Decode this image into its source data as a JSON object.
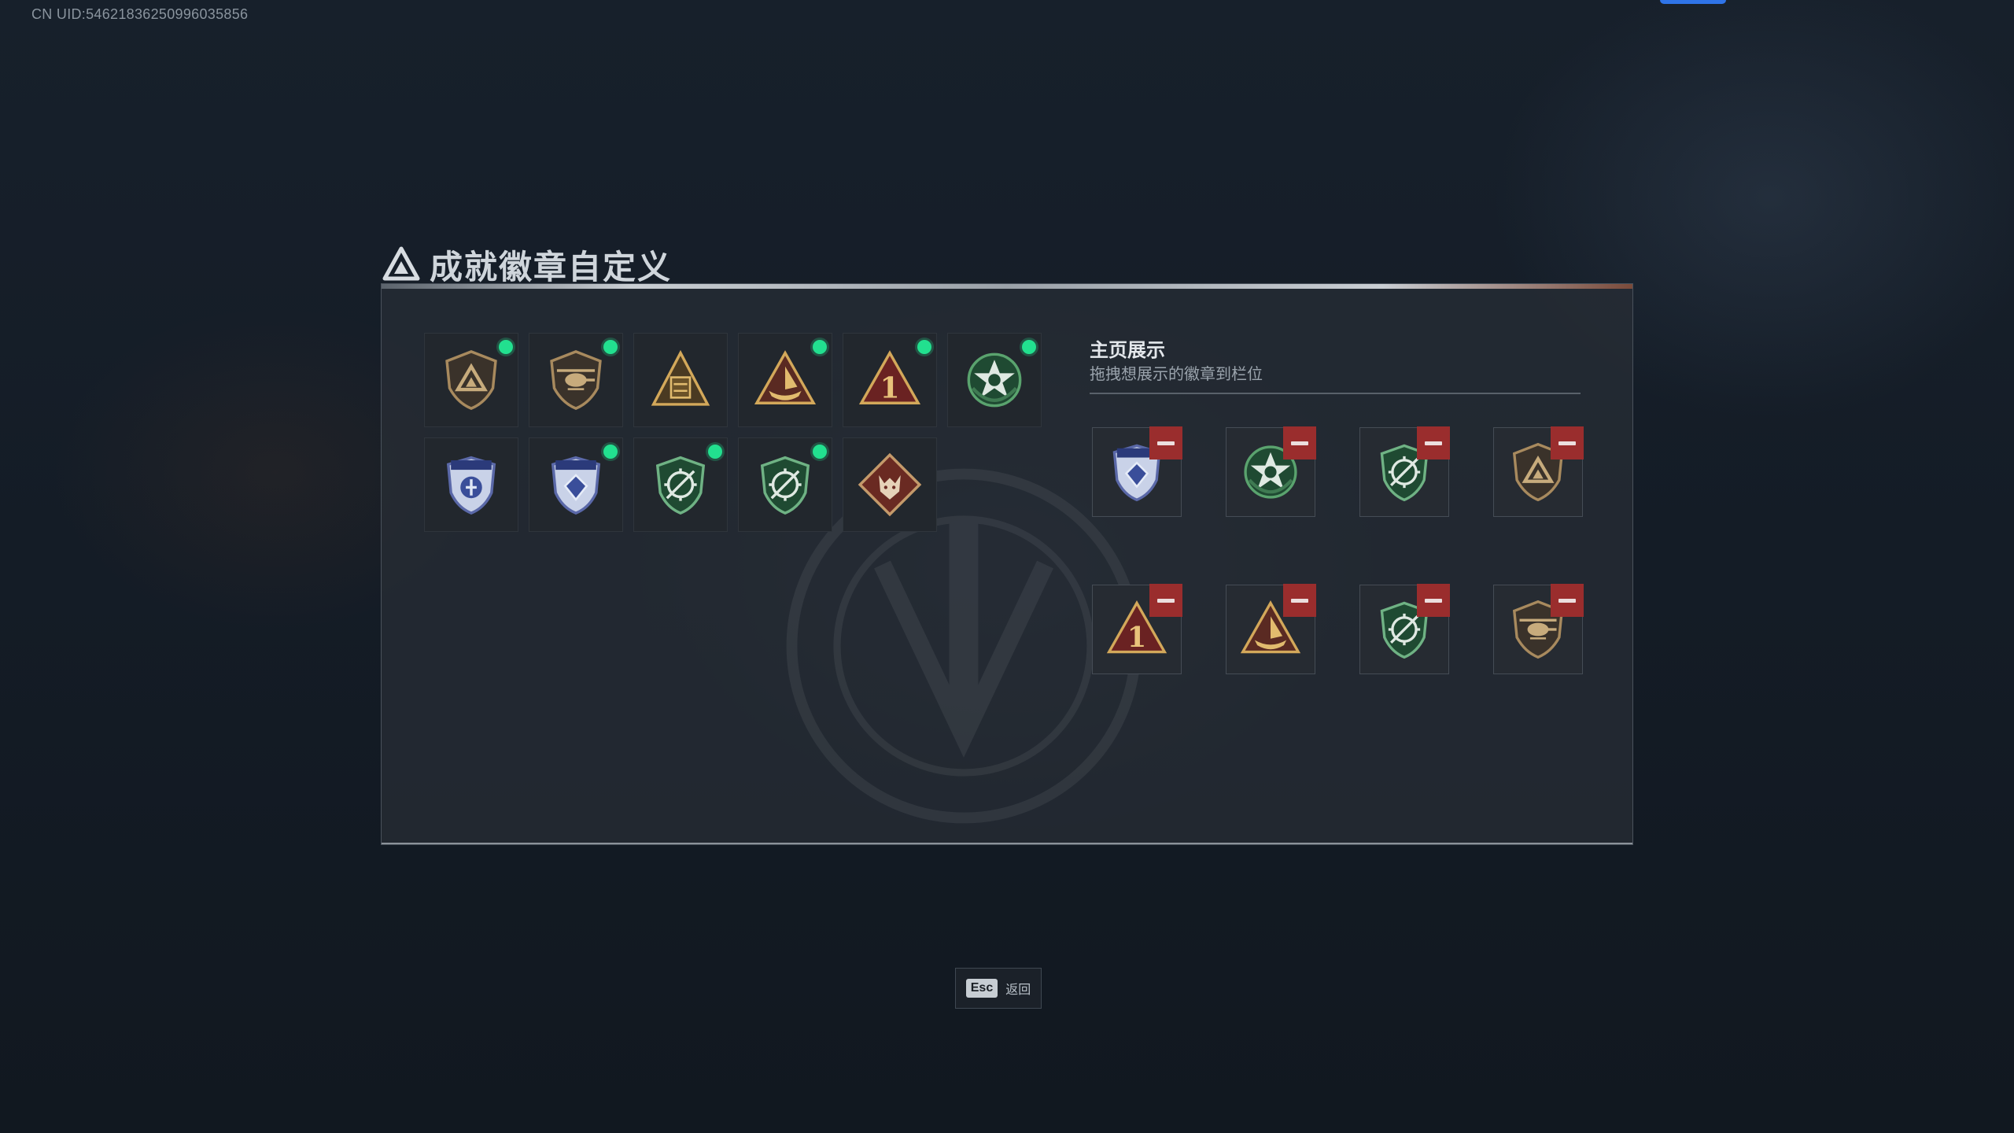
{
  "header": {
    "uid": "CN UID:546218362509960358​56"
  },
  "page": {
    "title": "成就徽章自定义"
  },
  "inventory": {
    "badges": [
      {
        "icon": "bronze-shield-triangle-badge",
        "new": true
      },
      {
        "icon": "bronze-helicopter-badge",
        "new": true
      },
      {
        "icon": "gold-pyramid-crate-badge",
        "new": false
      },
      {
        "icon": "gold-triangle-boat-badge",
        "new": true
      },
      {
        "icon": "red-triangle-number-one-badge",
        "new": true
      },
      {
        "icon": "green-star-wreath-badge",
        "new": true
      },
      {
        "icon": "blue-shield-emblem-badge",
        "new": false
      },
      {
        "icon": "blue-shield-diamond-badge",
        "new": true
      },
      {
        "icon": "green-shield-crosshair-badge",
        "new": true
      },
      {
        "icon": "green-shield-crosshair-badge",
        "new": true
      },
      {
        "icon": "red-diamond-wolf-badge",
        "new": false
      }
    ]
  },
  "display": {
    "title": "主页展示",
    "subtitle": "拖拽想展示的徽章到栏位",
    "slots": [
      {
        "icon": "blue-shield-diamond-badge"
      },
      {
        "icon": "green-star-wreath-badge"
      },
      {
        "icon": "green-shield-crosshair-badge"
      },
      {
        "icon": "bronze-shield-triangle-badge"
      },
      {
        "icon": "red-triangle-number-one-badge"
      },
      {
        "icon": "gold-triangle-boat-badge"
      },
      {
        "icon": "green-shield-crosshair-badge"
      },
      {
        "icon": "bronze-helicopter-badge"
      }
    ]
  },
  "footer": {
    "esc_key": "Esc",
    "esc_label": "返回"
  },
  "colors": {
    "new_dot": "#22e08f",
    "remove": "#9a2d2d",
    "accent_blue": "#2f74e8"
  }
}
